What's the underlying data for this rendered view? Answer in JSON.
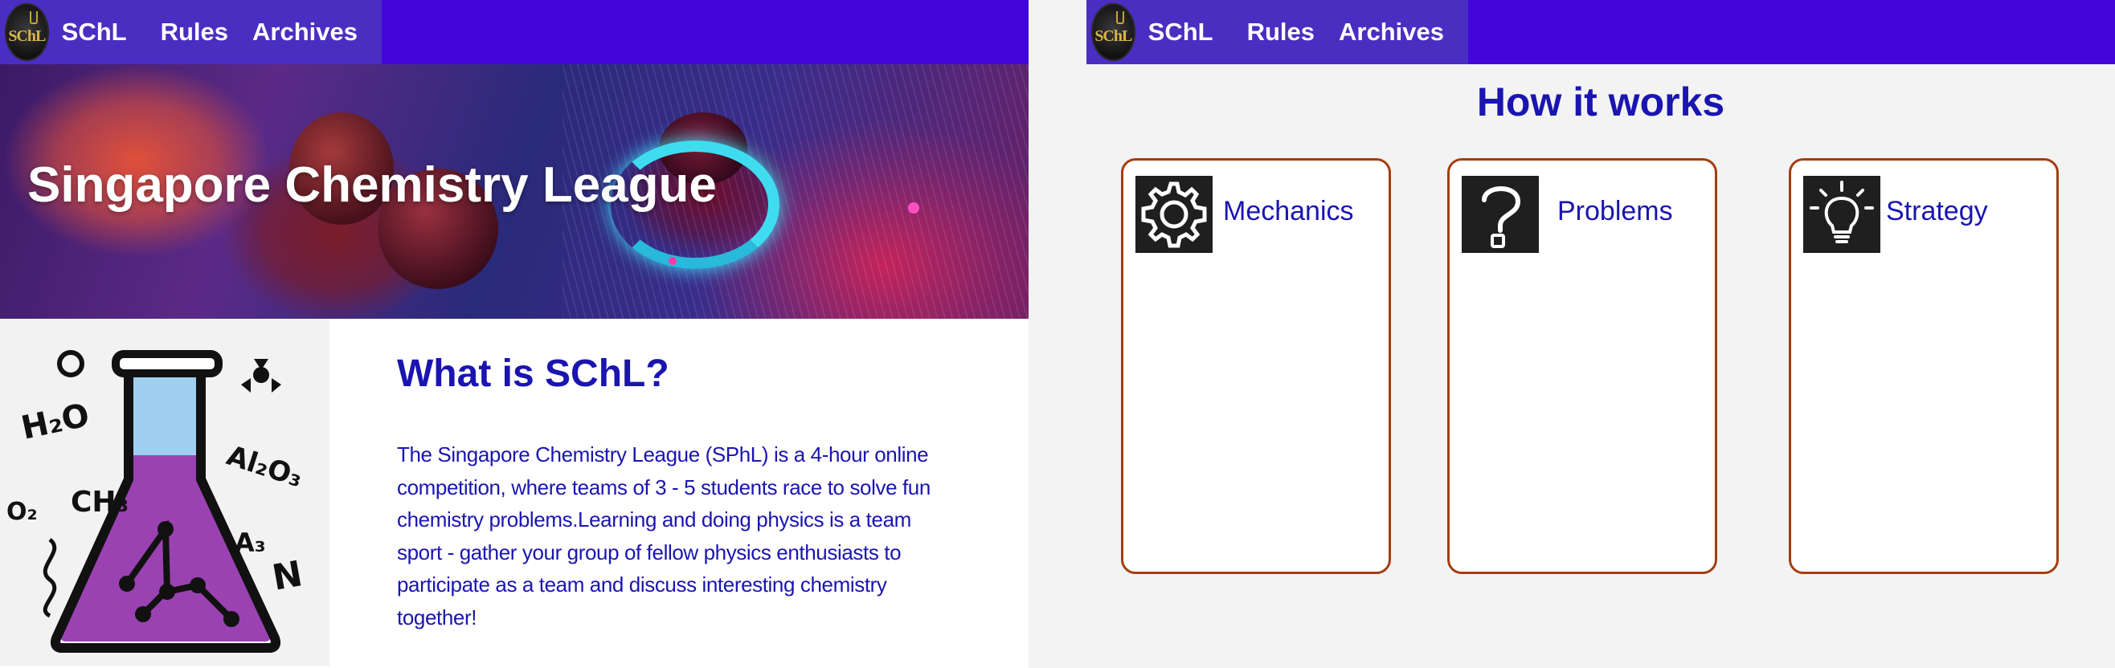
{
  "colors": {
    "nav_bg": "#4305d9",
    "nav_inner_bg": "#4a2ec2",
    "heading_blue": "#1a15b0",
    "card_border": "#a33d12"
  },
  "left_page": {
    "nav": {
      "logo_text": "SChL",
      "brand": "SChL",
      "links": [
        "Rules",
        "Archives"
      ]
    },
    "hero": {
      "title": "Singapore Chemistry League"
    },
    "about": {
      "heading": "What is SChL?",
      "body": "The Singapore Chemistry League (SPhL) is a 4-hour online competition, where teams of 3 - 5 students race to solve fun chemistry problems.Learning and doing physics is a team sport - gather your group of fellow physics enthusiasts to participate as a team and discuss interesting chemistry together!",
      "flask_labels": [
        "H₂O",
        "CH₃",
        "Al₂O₃",
        "O₂",
        "A₃",
        "N"
      ]
    }
  },
  "right_page": {
    "nav": {
      "logo_text": "SChL",
      "brand": "SChL",
      "links": [
        "Rules",
        "Archives"
      ]
    },
    "how": {
      "heading": "How it works",
      "cards": [
        {
          "label": "Mechanics",
          "icon": "gear-icon"
        },
        {
          "label": "Problems",
          "icon": "question-mark-icon"
        },
        {
          "label": "Strategy",
          "icon": "lightbulb-icon"
        }
      ]
    }
  }
}
